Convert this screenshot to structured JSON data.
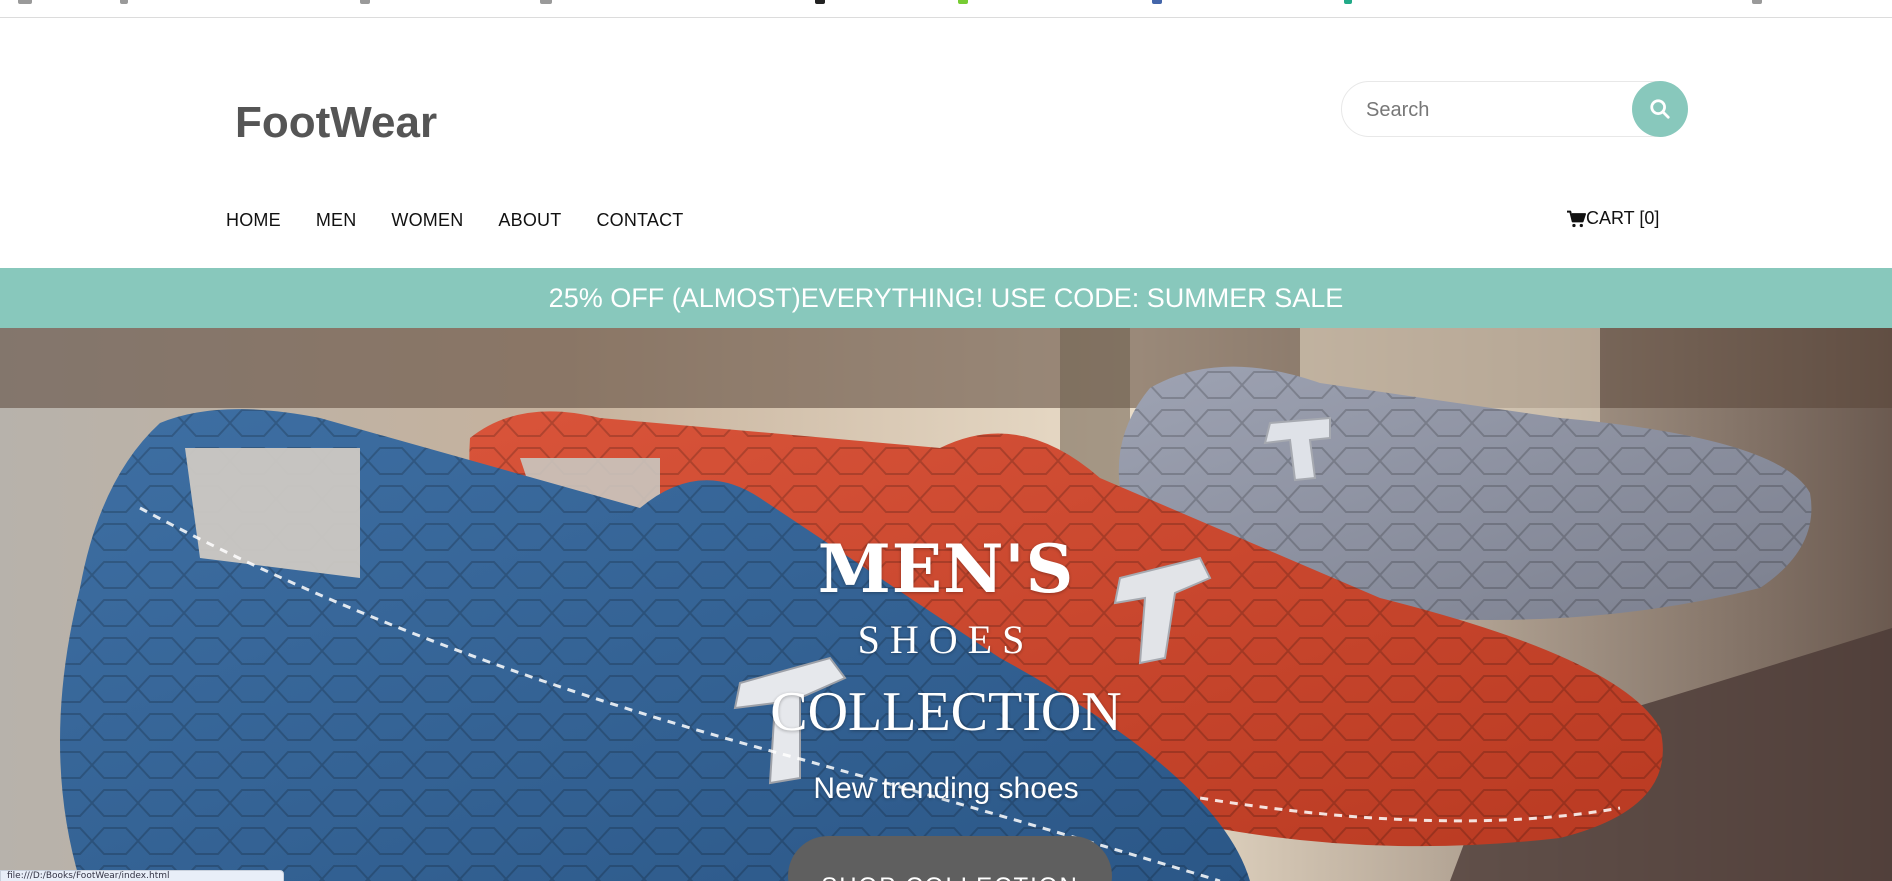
{
  "brand": {
    "name": "FootWear"
  },
  "search": {
    "placeholder": "Search",
    "button_icon": "search-icon"
  },
  "nav": {
    "items": [
      {
        "label": "HOME"
      },
      {
        "label": "MEN"
      },
      {
        "label": "WOMEN"
      },
      {
        "label": "ABOUT"
      },
      {
        "label": "CONTACT"
      }
    ],
    "cart": {
      "label": "CART [0]",
      "icon": "cart-icon"
    }
  },
  "promo": {
    "text": "25% OFF (ALMOST)EVERYTHING! USE CODE: SUMMER SALE"
  },
  "hero": {
    "title": "MEN'S",
    "subtitle": "SHOES",
    "title2": "COLLECTION",
    "tagline": "New trending shoes",
    "cta_label": "SHOP COLLECTION"
  },
  "status": {
    "url": "file:///D:/Books/FootWear/index.html"
  },
  "colors": {
    "accent": "#88c8bc",
    "button": "#5f5f5f",
    "text": "#111111"
  }
}
